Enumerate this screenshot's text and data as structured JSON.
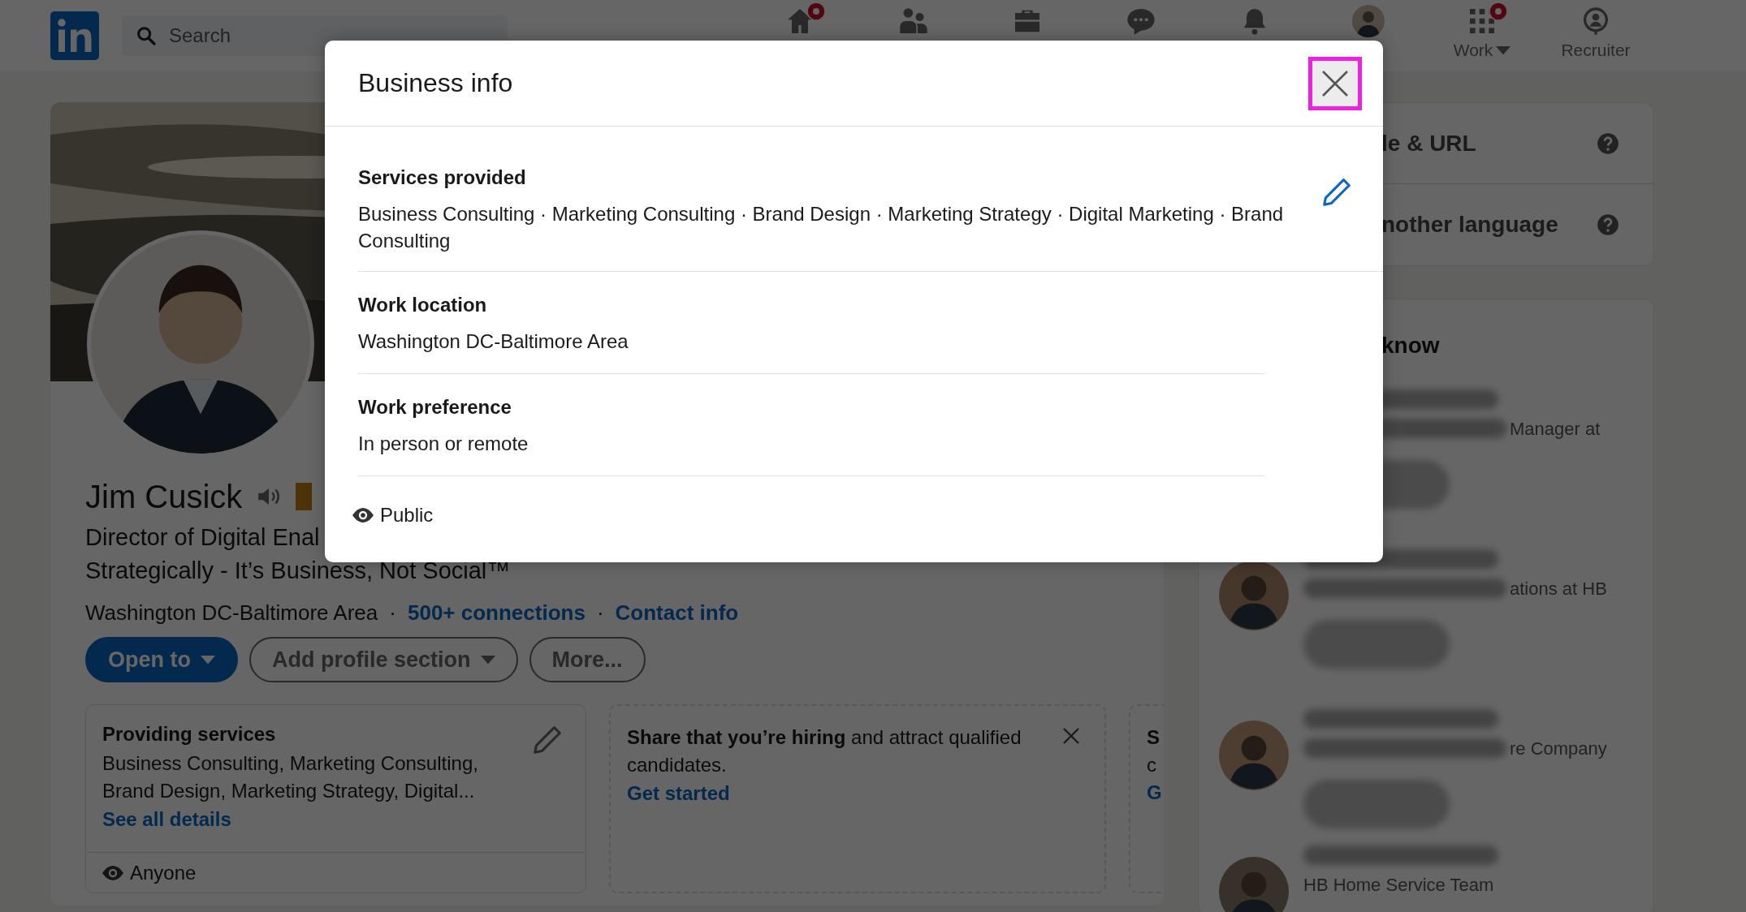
{
  "navbar": {
    "search": {
      "placeholder": "Search"
    },
    "items": [
      {
        "badge": true
      },
      {
        "badge": false
      },
      {
        "badge": false
      },
      {
        "badge": false
      },
      {
        "badge": false
      },
      {
        "badge": false
      },
      {
        "badge": true,
        "label": "Work",
        "caret": true
      },
      {
        "badge": false,
        "label": "Recruiter",
        "caret": false
      }
    ]
  },
  "profile": {
    "name": "Jim Cusick",
    "headline": [
      "Director of Digital Enal",
      "Strategically - It’s Business, Not Social™"
    ],
    "location": "Washington DC-Baltimore Area",
    "separator": "·",
    "connections": "500+ connections",
    "separator_2": "·",
    "contact": "Contact info",
    "buttons": [
      {
        "label": "Open to",
        "kind": "primary",
        "caret": true
      },
      {
        "label": "Add profile section",
        "kind": "outline",
        "caret": true
      },
      {
        "label": "More...",
        "kind": "outline",
        "caret": false
      }
    ],
    "cards": [
      {
        "kind": "services",
        "title": "Providing services",
        "text": "Business Consulting, Marketing Consulting, Brand Design, Marketing Strategy, Digital...",
        "link": "See all details",
        "visibility": "Anyone"
      },
      {
        "kind": "hiring",
        "text": "**Share that you’re hiring** and attract qualified candidates.",
        "link": "Get started"
      },
      {
        "kind": "cut",
        "lines": [
          "S",
          "c",
          "G"
        ]
      }
    ]
  },
  "sidebar": {
    "settings": [
      "le & URL",
      "nother language"
    ],
    "people_title": "know",
    "people": [
      {
        "text": "Manager at"
      },
      {
        "avatar": true,
        "text": "ations at HB"
      },
      {
        "avatar": true,
        "text": "re Company"
      },
      {
        "avatar": true,
        "text": "HB Home Service Team"
      }
    ]
  },
  "modal": {
    "title": "Business info",
    "sections": [
      {
        "heading": "Services provided",
        "value": "Business Consulting · Marketing Consulting · Brand Design · Marketing Strategy · Digital Marketing · Brand Consulting",
        "editable": true
      },
      {
        "heading": "Work location",
        "value": "Washington DC-Baltimore Area",
        "editable": false
      },
      {
        "heading": "Work preference",
        "value": "In person or remote",
        "editable": false
      }
    ],
    "visibility": "Public"
  }
}
